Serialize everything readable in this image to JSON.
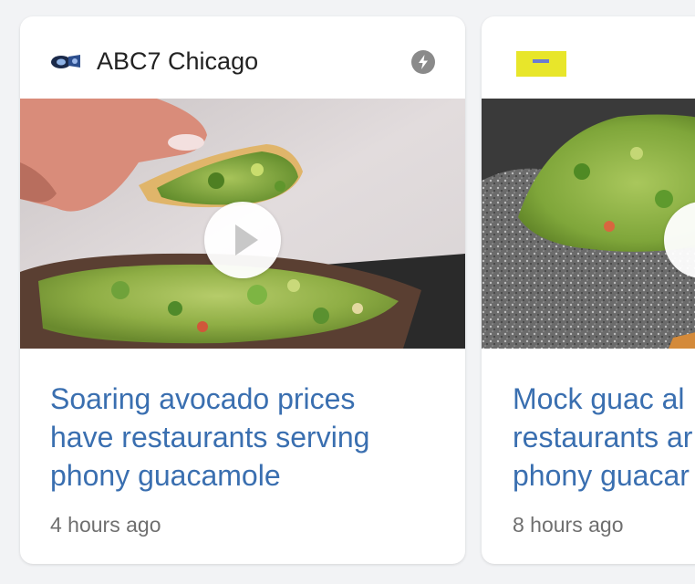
{
  "cards": [
    {
      "source": "ABC7 Chicago",
      "headline_lines": [
        "Soaring avocado prices",
        "have restaurants serving",
        "phony guacamole"
      ],
      "time": "4 hours ago",
      "logo_icon": "abc7-logo-icon",
      "amp_icon": "lightning-bolt-icon",
      "media_icon": "play-icon"
    },
    {
      "headline_lines": [
        "Mock guac al",
        "restaurants ar",
        "phony guacar"
      ],
      "time": "8 hours ago",
      "logo_icon": "publisher-logo-icon",
      "media_icon": "play-icon"
    }
  ],
  "colors": {
    "headline": "#3a6fb0",
    "source_text": "#222222",
    "timestamp": "#6f6f6f",
    "page_background": "#f2f3f5",
    "card_background": "#ffffff"
  }
}
